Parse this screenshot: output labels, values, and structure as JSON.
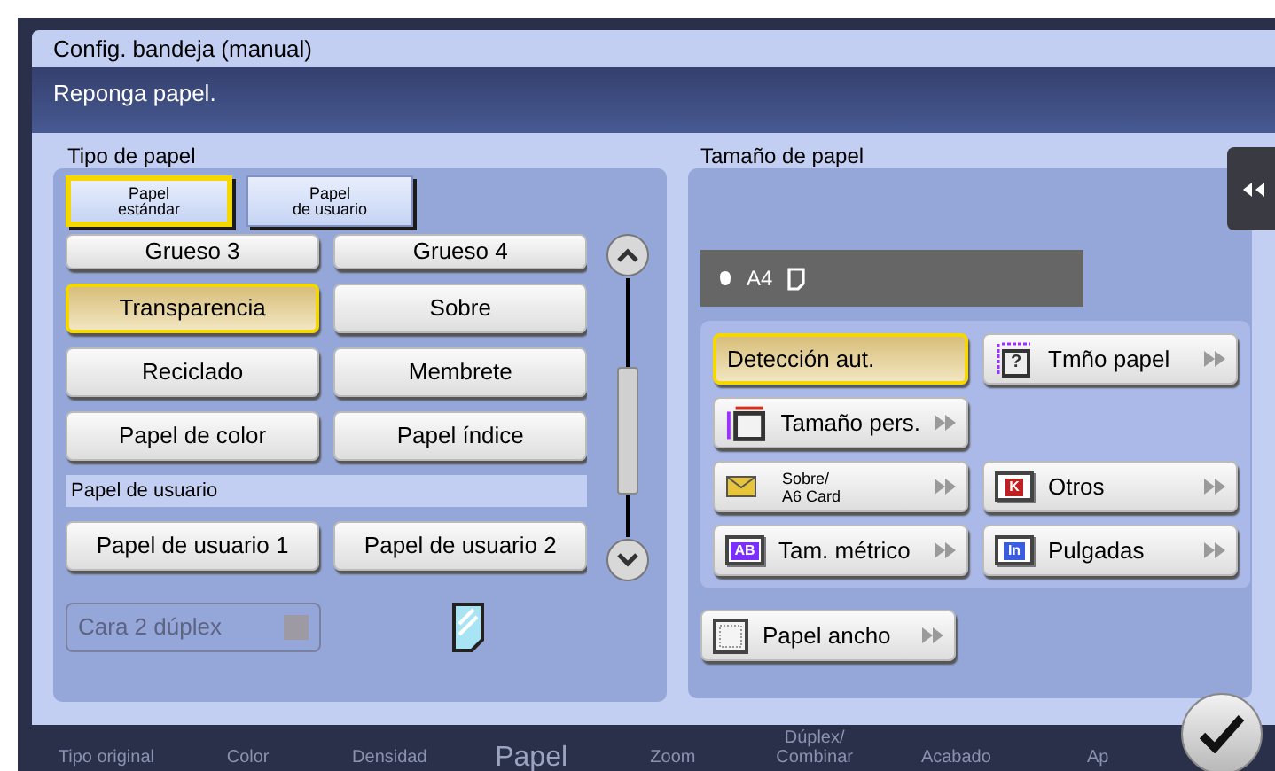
{
  "dialog": {
    "title": "Config. bandeja (manual)",
    "message": "Reponga papel."
  },
  "paper_type": {
    "heading": "Tipo de papel",
    "tabs": [
      {
        "label": "Papel estándar",
        "selected": true
      },
      {
        "label": "Papel de usuario",
        "selected": false
      }
    ],
    "items": [
      {
        "kind": "button",
        "label": "Grueso 3",
        "selected": false
      },
      {
        "kind": "button",
        "label": "Grueso 4",
        "selected": false
      },
      {
        "kind": "button",
        "label": "Transparencia",
        "selected": true
      },
      {
        "kind": "button",
        "label": "Sobre",
        "selected": false
      },
      {
        "kind": "button",
        "label": "Reciclado",
        "selected": false
      },
      {
        "kind": "button",
        "label": "Membrete",
        "selected": false
      },
      {
        "kind": "button",
        "label": "Papel de color",
        "selected": false
      },
      {
        "kind": "button",
        "label": "Papel índice",
        "selected": false
      },
      {
        "kind": "section",
        "label": "Papel de usuario"
      },
      {
        "kind": "button",
        "label": "Papel de usuario 1",
        "selected": false
      },
      {
        "kind": "button",
        "label": "Papel de usuario 2",
        "selected": false
      }
    ],
    "duplex": {
      "label": "Cara 2 dúplex",
      "disabled": true
    }
  },
  "paper_size": {
    "heading": "Tamaño de papel",
    "current": "A4",
    "option_rows": [
      [
        {
          "kind": "auto",
          "label": "Detección aut.",
          "selected": true
        },
        {
          "kind": "question",
          "badge": "?",
          "label": "Tmño papel",
          "selected": false
        }
      ],
      [
        {
          "kind": "custom",
          "label": "Tamaño pers.",
          "selected": false
        }
      ],
      [
        {
          "kind": "envelope",
          "label": "Sobre/\nA6 Card",
          "selected": false
        },
        {
          "kind": "badge",
          "badge": "K",
          "label": "Otros",
          "selected": false
        }
      ],
      [
        {
          "kind": "badge",
          "badge": "AB",
          "label": "Tam. métrico",
          "selected": false
        },
        {
          "kind": "badge",
          "badge": "In",
          "label": "Pulgadas",
          "selected": false
        }
      ]
    ],
    "wide": {
      "kind": "wide",
      "label": "Papel ancho"
    }
  },
  "bottom_bar": [
    {
      "label": "Tipo original",
      "selected": false
    },
    {
      "label": "Color",
      "selected": false
    },
    {
      "label": "Densidad",
      "selected": false
    },
    {
      "label": "Papel",
      "selected": true
    },
    {
      "label": "Zoom",
      "selected": false
    },
    {
      "label": "Dúplex/\nCombinar",
      "selected": false
    },
    {
      "label": "Acabado",
      "selected": false
    },
    {
      "label": "Ap",
      "selected": false
    }
  ]
}
